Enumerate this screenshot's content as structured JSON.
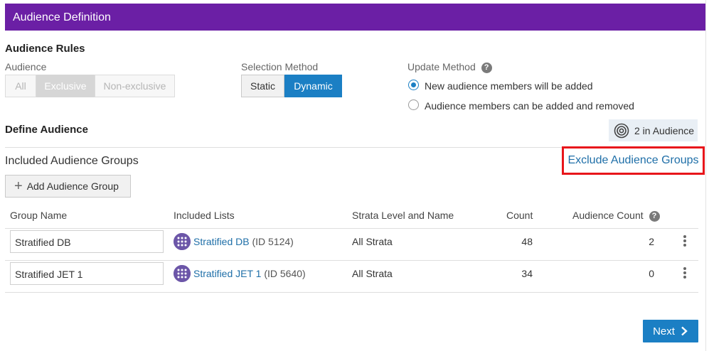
{
  "header": {
    "title": "Audience Definition"
  },
  "rules": {
    "heading": "Audience Rules",
    "audience": {
      "label": "Audience",
      "options": [
        "All",
        "Exclusive",
        "Non-exclusive"
      ],
      "selected": "Exclusive"
    },
    "selection_method": {
      "label": "Selection Method",
      "options": [
        "Static",
        "Dynamic"
      ],
      "selected": "Dynamic"
    },
    "update_method": {
      "label": "Update Method",
      "options": [
        "New audience members will be added",
        "Audience members can be added and removed"
      ],
      "selected": "New audience members will be added"
    }
  },
  "define": {
    "heading": "Define Audience",
    "audience_count_badge": "2 in Audience",
    "included_heading": "Included Audience Groups",
    "exclude_link": "Exclude Audience Groups",
    "add_button": "Add Audience Group"
  },
  "table": {
    "columns": [
      "Group Name",
      "Included Lists",
      "Strata Level and Name",
      "Count",
      "Audience Count"
    ],
    "rows": [
      {
        "group_name": "Stratified DB",
        "list_name": "Stratified DB",
        "list_id": "(ID 5124)",
        "strata": "All Strata",
        "count": "48",
        "audience_count": "2"
      },
      {
        "group_name": "Stratified JET 1",
        "list_name": "Stratified JET 1",
        "list_id": "(ID 5640)",
        "strata": "All Strata",
        "count": "34",
        "audience_count": "0"
      }
    ]
  },
  "footer": {
    "next_label": "Next"
  },
  "icons": {
    "help": "question-circle-icon",
    "target": "target-icon",
    "list": "grid-list-icon",
    "more": "kebab-menu-icon",
    "plus": "plus-icon",
    "next": "chevron-right-icon"
  },
  "colors": {
    "header": "#6b1fa5",
    "primary": "#1b7fc4",
    "link": "#1f6fa8",
    "highlight": "#e8161b"
  }
}
